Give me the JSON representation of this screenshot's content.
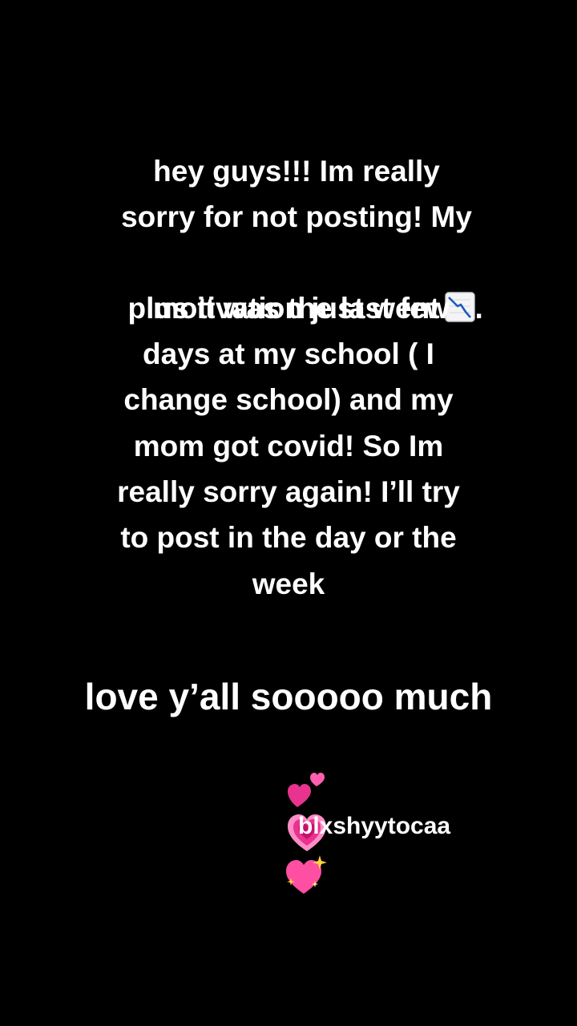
{
  "post": {
    "lines": [
      "hey guys!!! Im really",
      "sorry for not posting! My",
      "motivation just went",
      "plus it was the last few",
      "days at my school ( I",
      "change school) and my",
      "mom got covid! So Im",
      "really sorry again! I’ll try",
      "to post in the day or the",
      "week"
    ],
    "line3_suffix": ".",
    "line3_emoji": "chart-decreasing-icon",
    "love_text": "love y’all sooooo much",
    "hearts": [
      "two-hearts-icon",
      "growing-heart-icon",
      "sparkling-heart-icon"
    ],
    "signature": "blxshyytocaa"
  },
  "colors": {
    "background": "#000000",
    "text": "#ffffff",
    "heart_pink": "#e8338f",
    "heart_light": "#ff7fc0",
    "chart_line": "#1e5bbf"
  }
}
